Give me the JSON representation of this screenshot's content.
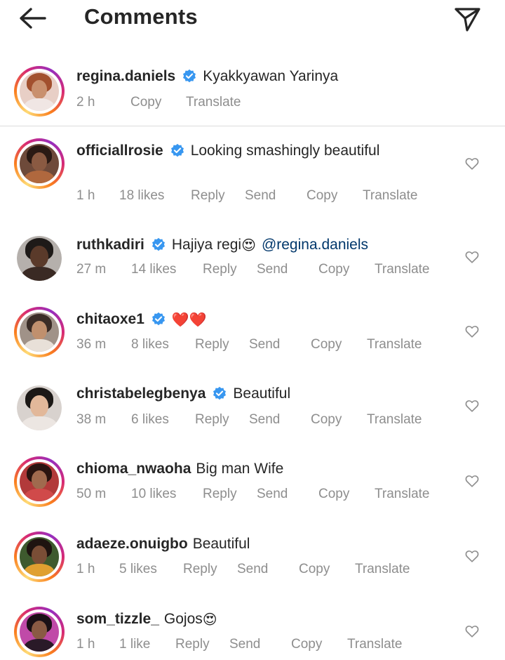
{
  "header": {
    "title": "Comments",
    "back_icon": "arrow-left-icon",
    "send_icon": "paper-plane-icon"
  },
  "caption": {
    "username": "regina.daniels",
    "verified": true,
    "text": "Kyakkyawan Yarinya",
    "time": "2 h",
    "copy": "Copy",
    "translate": "Translate"
  },
  "colors": {
    "verified": "#3897f0",
    "heart": "#8e8e8e",
    "emoji_heart": "#e0245e",
    "mention": "#00376b",
    "meta": "#8e8e8e"
  },
  "comments": [
    {
      "username": "officiallrosie",
      "verified": true,
      "text": "Looking smashingly beautiful",
      "time": "1 h",
      "likes": "18 likes",
      "reply": "Reply",
      "send": "Send",
      "copy": "Copy",
      "translate": "Translate"
    },
    {
      "username": "ruthkadiri",
      "verified": true,
      "text": "Hajiya regi",
      "emoji": "😍",
      "mention": "@regina.daniels",
      "time": "27 m",
      "likes": "14 likes",
      "reply": "Reply",
      "send": "Send",
      "copy": "Copy",
      "translate": "Translate"
    },
    {
      "username": "chitaoxe1",
      "verified": true,
      "text": "",
      "emoji": "❤️❤️",
      "time": "36 m",
      "likes": "8 likes",
      "reply": "Reply",
      "send": "Send",
      "copy": "Copy",
      "translate": "Translate"
    },
    {
      "username": "christabelegbenya",
      "verified": true,
      "text": "Beautiful",
      "time": "38 m",
      "likes": "6 likes",
      "reply": "Reply",
      "send": "Send",
      "copy": "Copy",
      "translate": "Translate"
    },
    {
      "username": "chioma_nwaoha",
      "verified": false,
      "text": "Big man Wife",
      "time": "50 m",
      "likes": "10 likes",
      "reply": "Reply",
      "send": "Send",
      "copy": "Copy",
      "translate": "Translate"
    },
    {
      "username": "adaeze.onuigbo",
      "verified": false,
      "text": "Beautiful",
      "time": "1 h",
      "likes": "5 likes",
      "reply": "Reply",
      "send": "Send",
      "copy": "Copy",
      "translate": "Translate"
    },
    {
      "username": "som_tizzle_",
      "verified": false,
      "text": "Gojos",
      "emoji": "😍",
      "time": "1 h",
      "likes": "1 like",
      "reply": "Reply",
      "send": "Send",
      "copy": "Copy",
      "translate": "Translate"
    }
  ]
}
